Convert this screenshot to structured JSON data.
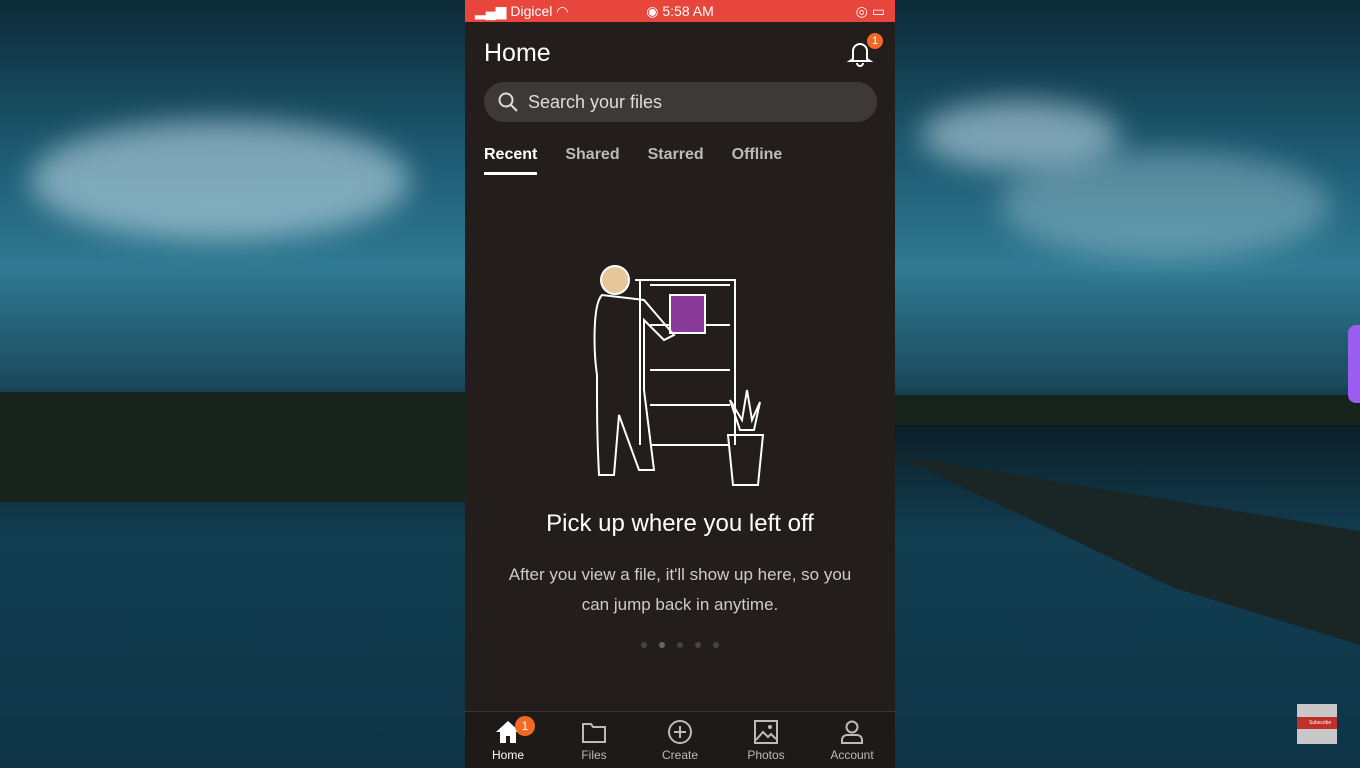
{
  "status_bar": {
    "carrier": "Digicel",
    "time": "5:58 AM"
  },
  "header": {
    "title": "Home",
    "notification_count": "1"
  },
  "search": {
    "placeholder": "Search your files"
  },
  "tabs": [
    {
      "label": "Recent",
      "active": true
    },
    {
      "label": "Shared"
    },
    {
      "label": "Starred"
    },
    {
      "label": "Offline"
    }
  ],
  "empty_state": {
    "title": "Pick up where you left off",
    "subtitle": "After you view a file, it'll show up here, so you can jump back in anytime."
  },
  "bottom_nav": [
    {
      "label": "Home",
      "icon": "home-icon",
      "badge": "1",
      "active": true
    },
    {
      "label": "Files",
      "icon": "folder-icon"
    },
    {
      "label": "Create",
      "icon": "plus-circle-icon"
    },
    {
      "label": "Photos",
      "icon": "photo-icon"
    },
    {
      "label": "Account",
      "icon": "person-icon"
    }
  ],
  "subscribe": {
    "label": "Subscribe"
  },
  "colors": {
    "status_bar": "#e8453c",
    "badge": "#f06a25",
    "app_bg": "#231e1c"
  }
}
